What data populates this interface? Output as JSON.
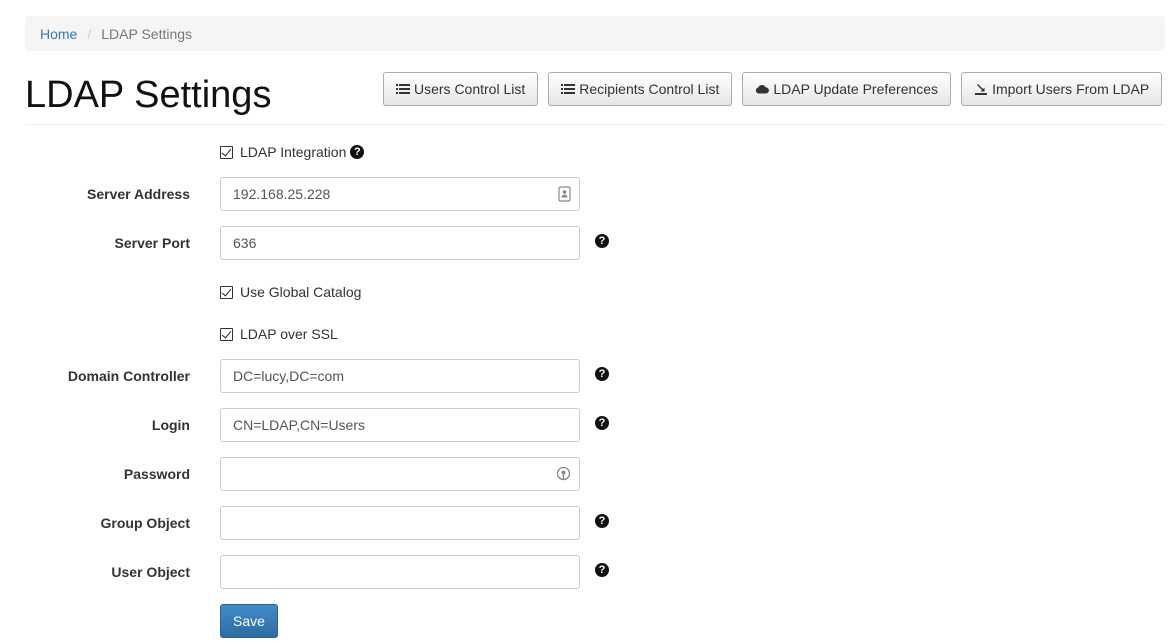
{
  "breadcrumb": {
    "home": "Home",
    "current": "LDAP Settings"
  },
  "page": {
    "title": "LDAP Settings"
  },
  "header_buttons": {
    "users_control_list": {
      "label": "Users Control List",
      "icon": "list-icon"
    },
    "recipients_control_list": {
      "label": "Recipients Control List",
      "icon": "list-icon"
    },
    "ldap_update_preferences": {
      "label": "LDAP Update Preferences",
      "icon": "cloud-icon"
    },
    "import_users": {
      "label": "Import Users From LDAP",
      "icon": "import-icon"
    }
  },
  "form": {
    "ldap_integration": {
      "label": "LDAP Integration",
      "checked": true
    },
    "server_address": {
      "label": "Server Address",
      "value": "192.168.25.228"
    },
    "server_port": {
      "label": "Server Port",
      "value": "636"
    },
    "use_global_catalog": {
      "label": "Use Global Catalog",
      "checked": true
    },
    "ldap_over_ssl": {
      "label": "LDAP over SSL",
      "checked": true
    },
    "domain_controller": {
      "label": "Domain Controller",
      "value": "DC=lucy,DC=com"
    },
    "login": {
      "label": "Login",
      "value": "CN=LDAP,CN=Users"
    },
    "password": {
      "label": "Password",
      "value": ""
    },
    "group_object": {
      "label": "Group Object",
      "value": ""
    },
    "user_object": {
      "label": "User Object",
      "value": ""
    }
  },
  "help_glyph": "?",
  "save_label": "Save",
  "colors": {
    "primary": "#337ab7",
    "save": "#3071a9",
    "breadcrumb_bg": "#f5f5f5"
  }
}
